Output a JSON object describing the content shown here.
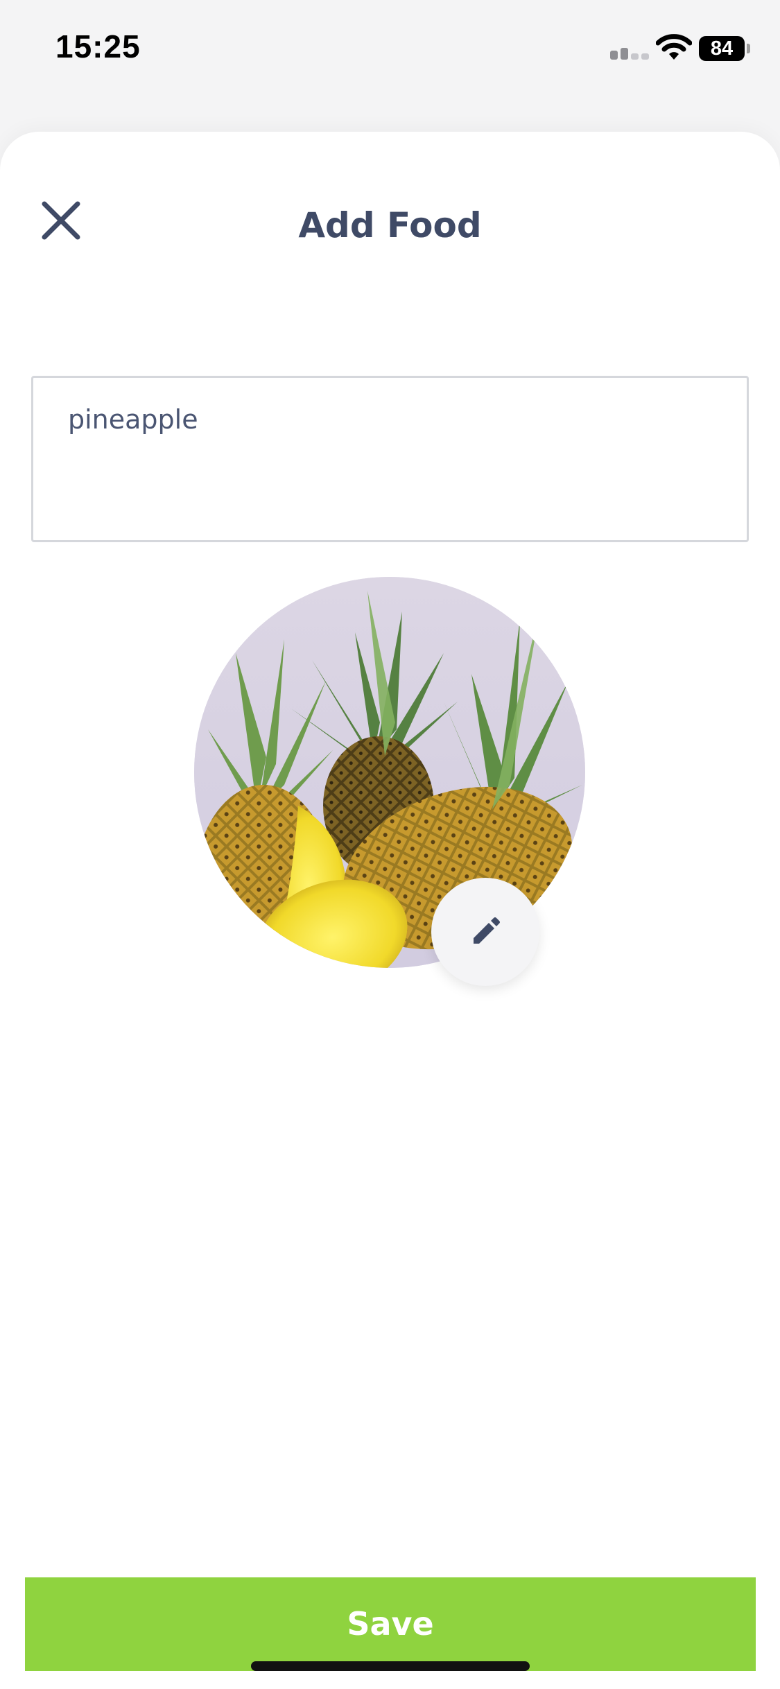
{
  "status_bar": {
    "time": "15:25",
    "battery_level": "84",
    "icons": [
      "cellular-signal-icon",
      "wifi-icon",
      "battery-icon"
    ]
  },
  "header": {
    "title": "Add Food",
    "close_icon": "close-icon"
  },
  "form": {
    "food_name_value": "pineapple",
    "photo_alt": "pineapple",
    "edit_photo_icon": "pencil-icon"
  },
  "actions": {
    "save_label": "Save"
  },
  "colors": {
    "accent": "#8fd33f",
    "title": "#3f4a66",
    "text": "#4a5572"
  }
}
